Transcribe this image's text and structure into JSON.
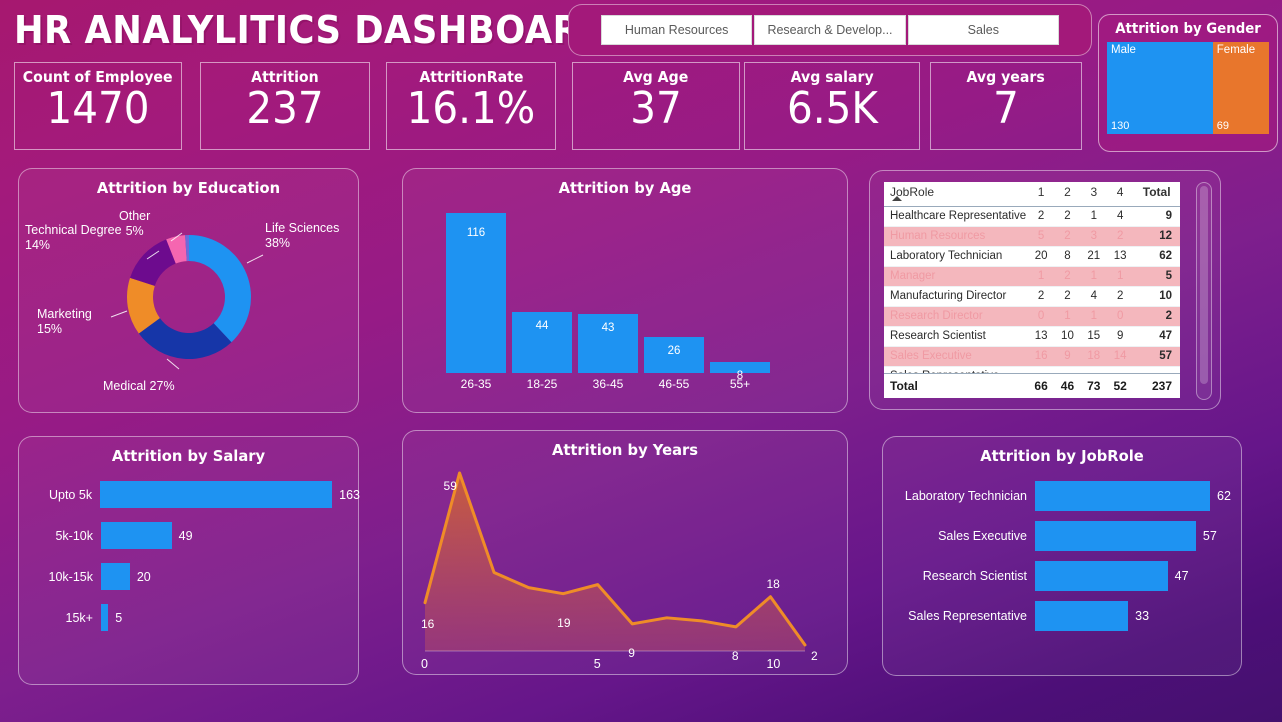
{
  "header": {
    "title": "HR ANALYLITICS DASHBOARD",
    "filters": [
      {
        "label": "Human Resources",
        "name": "filter-human-resources"
      },
      {
        "label": "Research & Develop...",
        "name": "filter-research-development"
      },
      {
        "label": "Sales",
        "name": "filter-sales"
      }
    ]
  },
  "kpis": [
    {
      "title": "Count of Employee",
      "value": "1470"
    },
    {
      "title": "Attrition",
      "value": "237"
    },
    {
      "title": "AttritionRate",
      "value": "16.1%"
    },
    {
      "title": "Avg Age",
      "value": "37"
    },
    {
      "title": "Avg salary",
      "value": "6.5K"
    },
    {
      "title": "Avg years",
      "value": "7"
    }
  ],
  "gender": {
    "title": "Attrition by Gender",
    "tiles": [
      {
        "label": "Male",
        "value": "130",
        "color": "#1e93f2",
        "share": 65.3
      },
      {
        "label": "Female",
        "value": "69",
        "color": "#e8762c",
        "share": 34.7
      }
    ]
  },
  "panels": {
    "education": "Attrition by Education",
    "age": "Attrition by Age",
    "salary": "Attrition by Salary",
    "years": "Attrition by Years",
    "jobrole": "Attrition by JobRole"
  },
  "chart_data": [
    {
      "type": "pie",
      "name": "attrition-by-education",
      "title": "Attrition by Education",
      "legend": "callout-labels",
      "slices": [
        {
          "label": "Life Sciences",
          "value": 38,
          "display": "38%",
          "color": "#1e93f2"
        },
        {
          "label": "Medical",
          "value": 27,
          "display": "27%",
          "color": "#1636a8"
        },
        {
          "label": "Marketing",
          "value": 15,
          "display": "15%",
          "color": "#ef8c28"
        },
        {
          "label": "Technical Degree",
          "value": 14,
          "display": "14%",
          "color": "#6d0b8e"
        },
        {
          "label": "Other",
          "value": 5,
          "display": "5%",
          "color": "#f566b0"
        },
        {
          "label": "",
          "value": 1,
          "display": "",
          "color": "#6f6bd8"
        }
      ]
    },
    {
      "type": "bar",
      "name": "attrition-by-age",
      "title": "Attrition by Age",
      "orientation": "vertical",
      "categories": [
        "26-35",
        "18-25",
        "36-45",
        "46-55",
        "55+"
      ],
      "values": [
        116,
        44,
        43,
        26,
        8
      ],
      "color": "#1e93f2",
      "xlabel": "",
      "ylabel": "",
      "ylim": [
        0,
        116
      ],
      "grid": false
    },
    {
      "type": "table",
      "name": "attrition-matrix-by-jobrole",
      "columns": [
        "JobRole",
        "1",
        "2",
        "3",
        "4",
        "Total"
      ],
      "rows": [
        {
          "role": "Healthcare Representative",
          "c": [
            "2",
            "2",
            "1",
            "4"
          ],
          "total": "9",
          "alt": false
        },
        {
          "role": "Human Resources",
          "c": [
            "5",
            "2",
            "3",
            "2"
          ],
          "total": "12",
          "alt": true
        },
        {
          "role": "Laboratory Technician",
          "c": [
            "20",
            "8",
            "21",
            "13"
          ],
          "total": "62",
          "alt": false
        },
        {
          "role": "Manager",
          "c": [
            "1",
            "2",
            "1",
            "1"
          ],
          "total": "5",
          "alt": true
        },
        {
          "role": "Manufacturing Director",
          "c": [
            "2",
            "2",
            "4",
            "2"
          ],
          "total": "10",
          "alt": false
        },
        {
          "role": "Research Director",
          "c": [
            "0",
            "1",
            "1",
            "0"
          ],
          "total": "2",
          "alt": true
        },
        {
          "role": "Research Scientist",
          "c": [
            "13",
            "10",
            "15",
            "9"
          ],
          "total": "47",
          "alt": false
        },
        {
          "role": "Sales Executive",
          "c": [
            "16",
            "9",
            "18",
            "14"
          ],
          "total": "57",
          "alt": true
        },
        {
          "role": "Sales Representative",
          "c": [
            "",
            "",
            "",
            ""
          ],
          "total": "",
          "alt": false
        }
      ],
      "total_row": {
        "role": "Total",
        "c": [
          "66",
          "46",
          "73",
          "52"
        ],
        "total": "237"
      }
    },
    {
      "type": "bar",
      "name": "attrition-by-salary",
      "title": "Attrition by Salary",
      "orientation": "horizontal",
      "categories": [
        "Upto 5k",
        "5k-10k",
        "10k-15k",
        "15k+"
      ],
      "values": [
        163,
        49,
        20,
        5
      ],
      "color": "#1e93f2",
      "xlabel": "",
      "ylabel": "",
      "xlim": [
        0,
        163
      ],
      "grid": false
    },
    {
      "type": "area",
      "name": "attrition-by-years",
      "title": "Attrition by Years",
      "x": [
        0,
        1,
        2,
        3,
        4,
        5,
        6,
        7,
        8,
        9,
        10,
        11
      ],
      "values": [
        16,
        59,
        26,
        21,
        19,
        22,
        9,
        11,
        10,
        8,
        18,
        2
      ],
      "labeled_points": [
        {
          "x": 0,
          "y": 16,
          "label": "16"
        },
        {
          "x": 1,
          "y": 59,
          "label": "59"
        },
        {
          "x": 4,
          "y": 19,
          "label": "19"
        },
        {
          "x": 6,
          "y": 9,
          "label": "9"
        },
        {
          "x": 9,
          "y": 8,
          "label": "8"
        },
        {
          "x": 10,
          "y": 18,
          "label": "18"
        },
        {
          "x": 11,
          "y": 2,
          "label": "2"
        }
      ],
      "xticks": [
        "0",
        "5",
        "10"
      ],
      "line_color": "#ef8c28",
      "xlabel": "",
      "ylabel": "",
      "grid": false
    },
    {
      "type": "bar",
      "name": "attrition-by-jobrole",
      "title": "Attrition by JobRole",
      "orientation": "horizontal",
      "categories": [
        "Laboratory Technician",
        "Sales Executive",
        "Research Scientist",
        "Sales Representative"
      ],
      "values": [
        62,
        57,
        47,
        33
      ],
      "color": "#1e93f2",
      "xlabel": "",
      "ylabel": "",
      "xlim": [
        0,
        62
      ],
      "grid": false
    }
  ]
}
